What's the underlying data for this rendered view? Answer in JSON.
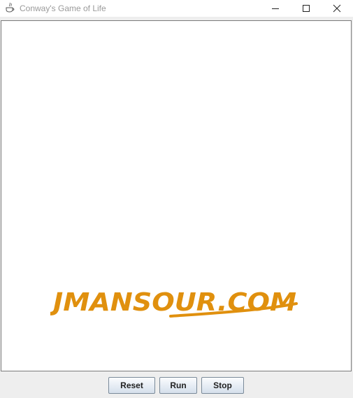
{
  "window": {
    "title": "Conway's Game of Life",
    "icon": "java-icon",
    "controls": [
      "minimize-icon",
      "maximize-icon",
      "close-icon"
    ]
  },
  "canvas": {
    "watermark_text": "JMANSOUR.COM",
    "watermark_color": "#e0900e"
  },
  "buttons": {
    "reset_label": "Reset",
    "run_label": "Run",
    "stop_label": "Stop"
  },
  "colors": {
    "window_bg": "#eeeeee",
    "canvas_bg": "#ffffff",
    "canvas_border": "#7a7a7a"
  }
}
